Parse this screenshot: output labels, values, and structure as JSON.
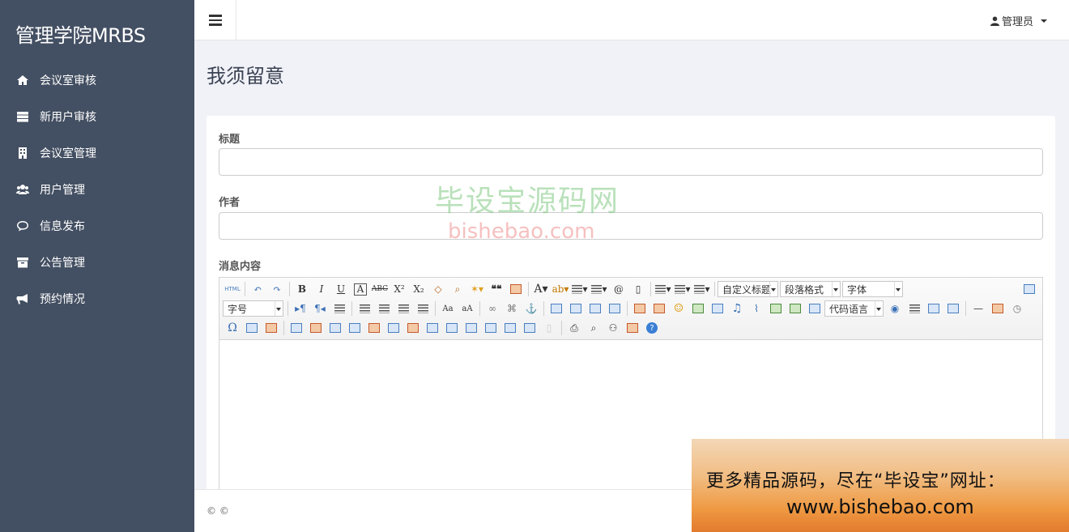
{
  "app": {
    "brand": "管理学院MRBS"
  },
  "sidebar": {
    "items": [
      {
        "label": "会议室审核",
        "icon": "home-icon"
      },
      {
        "label": "新用户审核",
        "icon": "server-icon"
      },
      {
        "label": "会议室管理",
        "icon": "building-icon"
      },
      {
        "label": "用户管理",
        "icon": "users-icon"
      },
      {
        "label": "信息发布",
        "icon": "comment-icon"
      },
      {
        "label": "公告管理",
        "icon": "archive-icon"
      },
      {
        "label": "预约情况",
        "icon": "bullhorn-icon"
      }
    ]
  },
  "header": {
    "user_label": "管理员"
  },
  "page": {
    "title": "我须留意"
  },
  "form": {
    "title_label": "标题",
    "title_value": "",
    "author_label": "作者",
    "author_value": "",
    "content_label": "消息内容"
  },
  "editor": {
    "html_label": "HTML",
    "combo_custom_heading": "自定义标题",
    "combo_paragraph": "段落格式",
    "combo_font": "字体",
    "combo_font_size": "字号",
    "combo_code_lang": "代码语言"
  },
  "footer": {
    "text": "© ©"
  },
  "watermark": {
    "cn": "毕设宝源码网",
    "en": "bishebao.com"
  },
  "ad": {
    "line1": "更多精品源码，尽在“毕设宝”网址：",
    "line2": "www.bishebao.com"
  },
  "colors": {
    "sidebar": "#434f62",
    "background": "#f1f2f7",
    "title": "#3b4354"
  }
}
